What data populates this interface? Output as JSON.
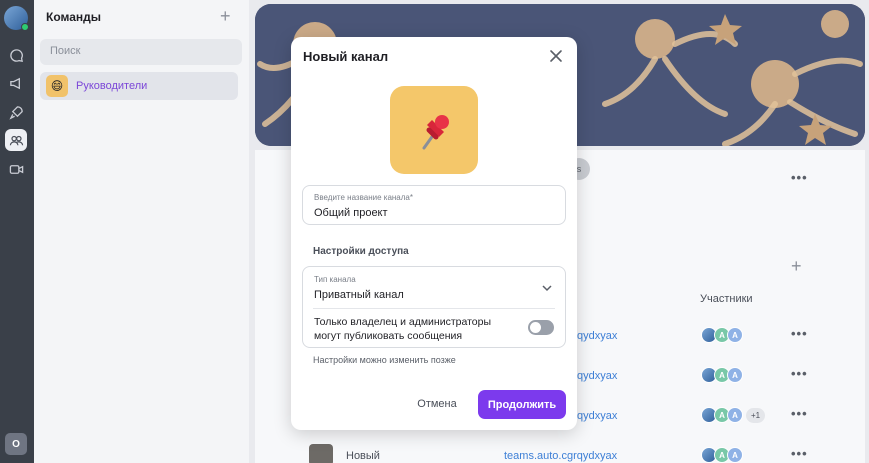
{
  "sidebar": {
    "title": "Команды",
    "search_placeholder": "Поиск",
    "items": [
      {
        "label": "Руководители"
      }
    ]
  },
  "rail": {
    "org_badge": "O",
    "icons": [
      "chat-icon",
      "megaphone-icon",
      "rocket-icon",
      "teams-icon",
      "video-icon"
    ]
  },
  "main_bg": {
    "participants_header": "Участники",
    "rows": [
      {
        "link": "teams.auto.cgrqydxyax",
        "avatars": [
          "A",
          "A"
        ],
        "extra": ""
      },
      {
        "link": "teams.auto.cgrqydxyax",
        "avatars": [
          "A",
          "A"
        ],
        "extra": ""
      },
      {
        "link": "teams.auto.cgrqydxyax",
        "avatars": [
          "A",
          "A"
        ],
        "extra": "+1"
      },
      {
        "name": "Новый",
        "link": "teams.auto.cgrqydxyax",
        "avatars": [
          "A",
          "A"
        ],
        "extra": ""
      }
    ],
    "link_suffix": "qydxyax",
    "chip_text": "s"
  },
  "dialog": {
    "title": "Новый канал",
    "name_label": "Введите название канала*",
    "name_value": "Общий проект",
    "access_section": "Настройки доступа",
    "type_label": "Тип канала",
    "type_value": "Приватный канал",
    "toggle_text": "Только владелец и администраторы могут публиковать сообщения",
    "toggle_on": false,
    "hint": "Настройки можно изменить позже",
    "cancel": "Отмена",
    "continue": "Продолжить",
    "accent_color": "#7c3aed",
    "icon_bg": "#f4c76a"
  }
}
